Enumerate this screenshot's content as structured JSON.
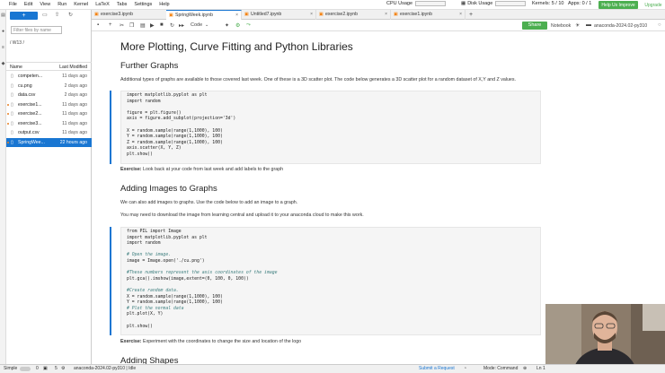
{
  "menubar": {
    "items": [
      "File",
      "Edit",
      "View",
      "Run",
      "Kernel",
      "LaTeX",
      "Tabs",
      "Settings",
      "Help"
    ],
    "cpu_label": "CPU Usage",
    "disk_label": "Disk Usage",
    "kernels": "Kernels: 5 / 10",
    "apps": "Apps: 0 / 1",
    "help_button": "Help Us Improve",
    "upgrade": "Upgrade"
  },
  "filebrowser": {
    "new_label": "+",
    "filter_placeholder": "Filter files by name",
    "breadcrumb": "/ W13 /",
    "col_name": "Name",
    "col_modified": "Last Modified",
    "files": [
      {
        "name": "competen...",
        "modified": "11 days ago",
        "running": false,
        "selected": false
      },
      {
        "name": "cu.png",
        "modified": "2 days ago",
        "running": false,
        "selected": false
      },
      {
        "name": "data.csv",
        "modified": "2 days ago",
        "running": false,
        "selected": false
      },
      {
        "name": "exercise1...",
        "modified": "11 days ago",
        "running": true,
        "selected": false
      },
      {
        "name": "exercise2...",
        "modified": "11 days ago",
        "running": true,
        "selected": false
      },
      {
        "name": "exercise3...",
        "modified": "11 days ago",
        "running": true,
        "selected": false
      },
      {
        "name": "output.csv",
        "modified": "11 days ago",
        "running": false,
        "selected": false
      },
      {
        "name": "SpringWee...",
        "modified": "22 hours ago",
        "running": true,
        "selected": true
      }
    ]
  },
  "tabs": [
    {
      "label": "exercise3.ipynb",
      "active": false
    },
    {
      "label": "SpringWeek.ipynb",
      "active": true
    },
    {
      "label": "Untitled7.ipynb",
      "active": false
    },
    {
      "label": "exercise2.ipynb",
      "active": false
    },
    {
      "label": "exercise1.ipynb",
      "active": false
    }
  ],
  "toolbar": {
    "cell_type": "Code",
    "share_label": "Share",
    "notebook_label": "Notebook",
    "kernel_name": "anaconda-2024.02-py310"
  },
  "notebook": {
    "title": "More Plotting, Curve Fitting and Python Libraries",
    "section1": "Further Graphs",
    "para1": "Additional types of graphs are available to those covered last week. One of these is a 3D scatter plot. The code below generates a 3D scatter plot for a random dataset of X,Y and Z values.",
    "exercise1_label": "Exercise:",
    "exercise1_text": " Look back at your code from last week and add labels to the graph",
    "section2": "Adding Images to Graphs",
    "para2": "We can also add images to graphs. Use the code below to add an image to a graph.",
    "para3": "You may need to download the image from learning central and upload it to your anaconda cloud to make this work.",
    "exercise2_label": "Exercise:",
    "exercise2_text": " Experiment with the coordinates to change the size and location of the logo",
    "section3": "Adding Shapes"
  },
  "code1": [
    "import matplotlib.pyplot as plt",
    "import random",
    "",
    "figure = plt.figure()",
    "axis = figure.add_subplot(projection='3d')",
    "",
    "X = random.sample(range(1,1000), 100)",
    "Y = random.sample(range(1,1000), 100)",
    "Z = random.sample(range(1,1000), 100)",
    "axis.scatter(X, Y, Z)",
    "plt.show()"
  ],
  "code2": [
    "from PIL import Image",
    "import matplotlib.pyplot as plt",
    "import random",
    "",
    "# Open the image.",
    "image = Image.open('./cu.png')",
    "",
    "#These numbers represent the axis coordinates of the image",
    "plt.gca().imshow(image,extent=(0, 100, 0, 100))",
    "",
    "#Create random data.",
    "X = random.sample(range(1,1000), 100)",
    "Y = random.sample(range(1,1000), 100)",
    "# Plot the normal data",
    "plt.plot(X, Y)",
    "",
    "plt.show()"
  ],
  "status": {
    "mode_label": "Simple",
    "count1": "0",
    "count2": "5",
    "kernel": "anaconda-2024.02-py310 | Idle",
    "submit_request": "Submit a Request",
    "mode": "Mode: Command",
    "line": "Ln 1"
  },
  "colors": {
    "accent": "#1976d2",
    "share": "#4caf50",
    "help": "#4caf50"
  }
}
